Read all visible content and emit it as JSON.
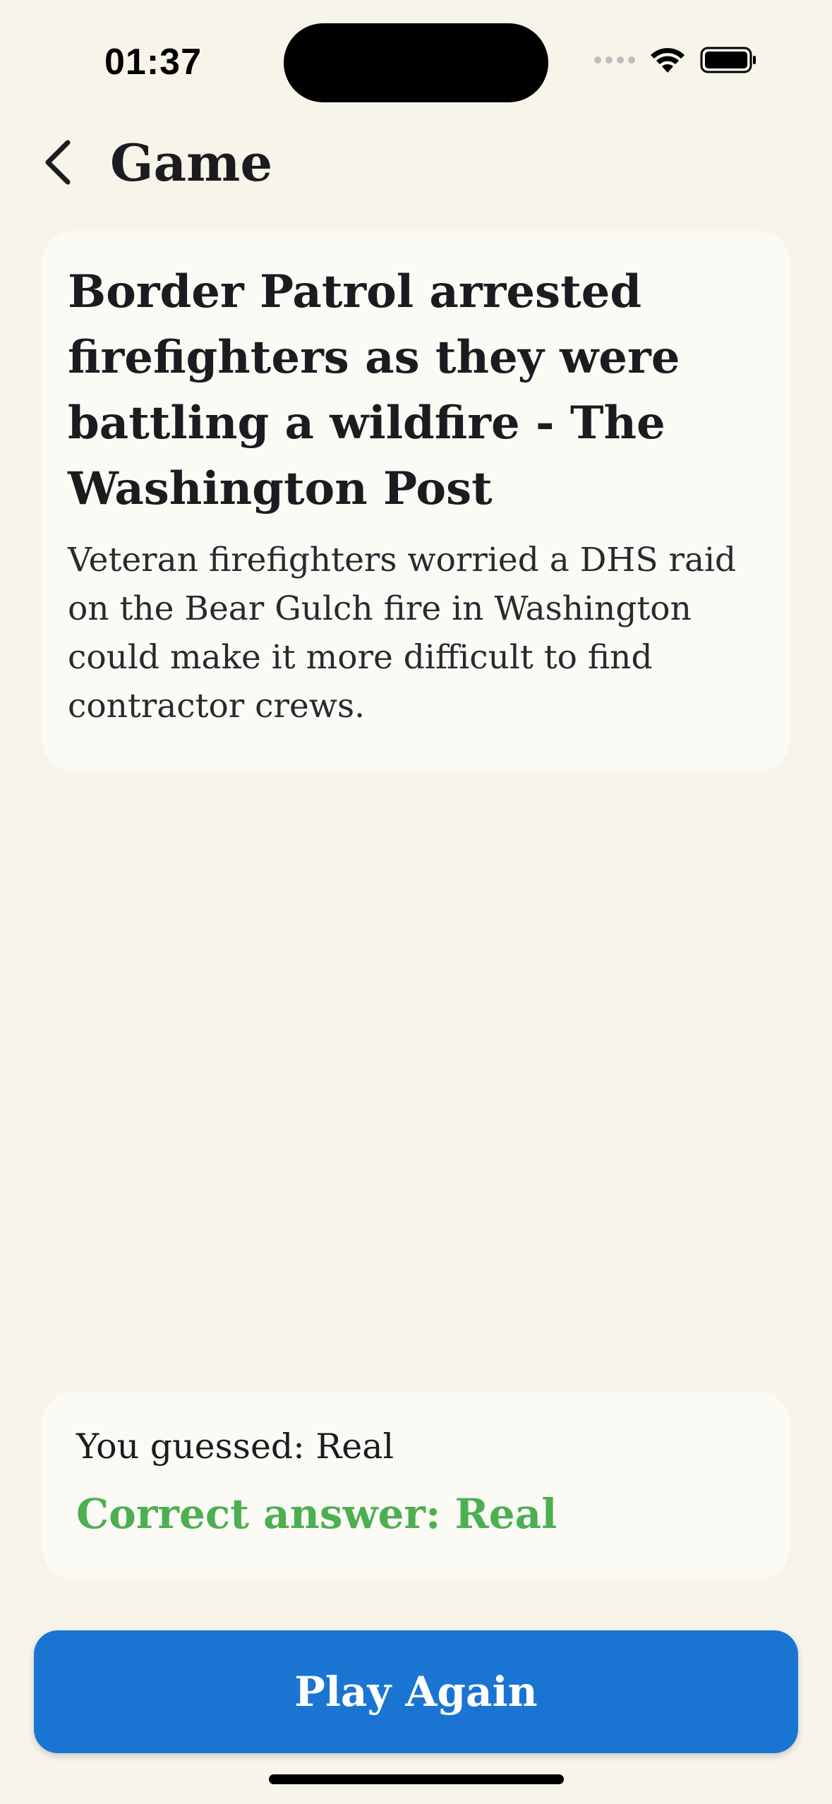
{
  "status_bar": {
    "time": "01:37",
    "icons": [
      "cellular-signal-icon",
      "wifi-icon",
      "battery-icon"
    ]
  },
  "nav": {
    "back_icon": "chevron-left-icon",
    "title": "Game"
  },
  "article": {
    "headline": "Border Patrol arrested firefighters as they were battling a wildfire - The Washington Post",
    "summary": "Veteran firefighters worried a DHS raid on the Bear Gulch fire in Washington could make it more difficult to find contractor crews."
  },
  "result": {
    "guess": "You guessed: Real",
    "correct": "Correct answer: Real",
    "correct_color": "#4CAF50"
  },
  "actions": {
    "play_again_label": "Play Again",
    "button_color": "#1A75D2"
  },
  "colors": {
    "background": "#F7F5EA",
    "card": "#FBFAF5"
  }
}
